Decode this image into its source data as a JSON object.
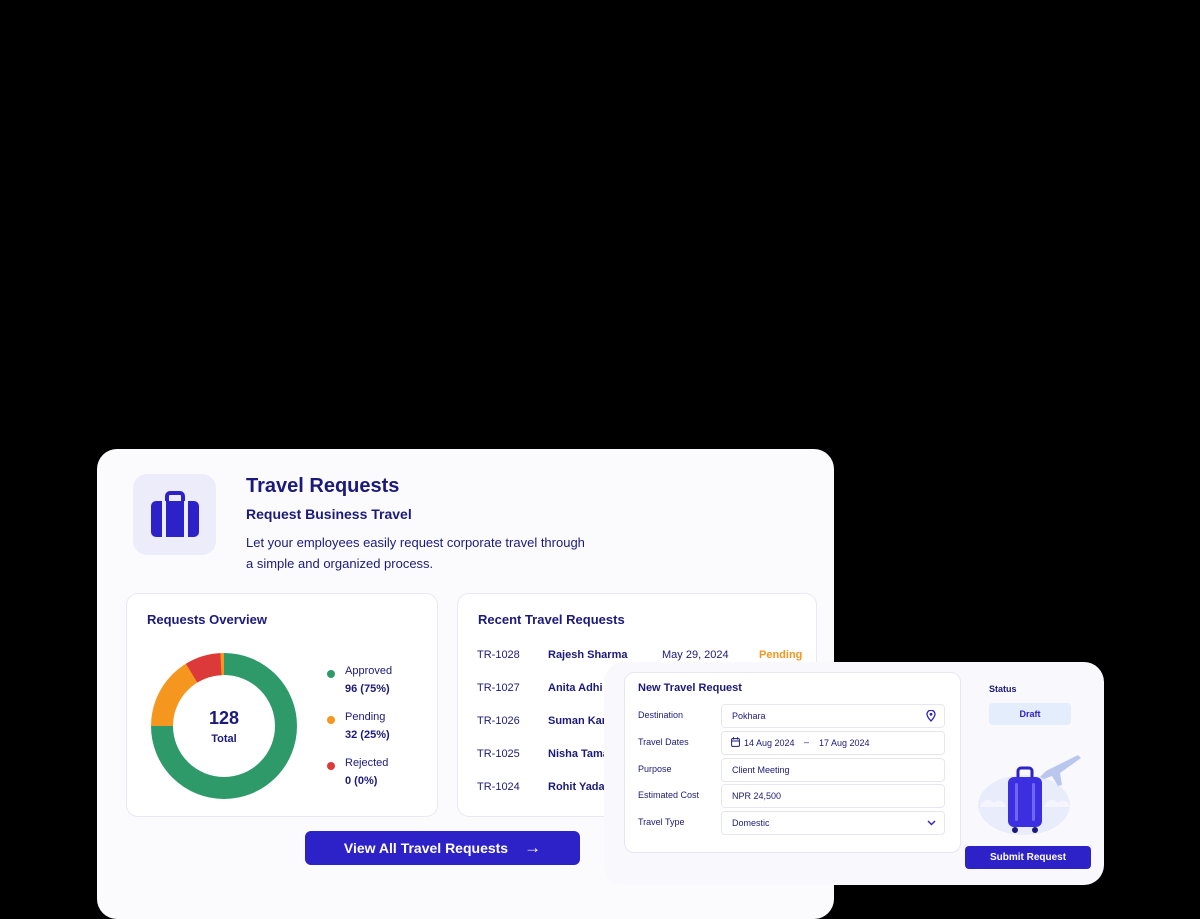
{
  "header": {
    "icon": "suitcase-icon",
    "title": "Travel Requests",
    "subtitle": "Request Business Travel",
    "description": "Let your employees easily request corporate travel through a simple and organized process."
  },
  "overview": {
    "title": "Requests Overview",
    "total": "128",
    "total_label": "Total",
    "legend": [
      {
        "name": "Approved",
        "value": "96 (75%)",
        "color": "#2f9a69"
      },
      {
        "name": "Pending",
        "value": "32 (25%)",
        "color": "#f5961e"
      },
      {
        "name": "Rejected",
        "value": "0 (0%)",
        "color": "#dc3a3a"
      }
    ]
  },
  "chart_data": {
    "type": "pie",
    "categories": [
      "Approved",
      "Pending",
      "Rejected"
    ],
    "values": [
      96,
      32,
      0
    ],
    "total": 128
  },
  "recent": {
    "title": "Recent Travel Requests",
    "rows": [
      {
        "id": "TR-1028",
        "name": "Rajesh Sharma",
        "date": "May 29, 2024",
        "status": "Pending"
      },
      {
        "id": "TR-1027",
        "name": "Anita Adhi",
        "date": "",
        "status": ""
      },
      {
        "id": "TR-1026",
        "name": "Suman Kar",
        "date": "",
        "status": ""
      },
      {
        "id": "TR-1025",
        "name": "Nisha Tama",
        "date": "",
        "status": ""
      },
      {
        "id": "TR-1024",
        "name": "Rohit Yada",
        "date": "",
        "status": ""
      }
    ]
  },
  "view_all_label": "View All Travel Requests",
  "form": {
    "title": "New Travel Request",
    "destination_label": "Destination",
    "destination_value": "Pokhara",
    "dates_label": "Travel Dates",
    "date_from": "14 Aug 2024",
    "date_separator": "–",
    "date_to": "17 Aug 2024",
    "purpose_label": "Purpose",
    "purpose_value": "Client Meeting",
    "cost_label": "Estimated Cost",
    "cost_value": "NPR 24,500",
    "type_label": "Travel Type",
    "type_value": "Domestic",
    "status_label": "Status",
    "status_value": "Draft",
    "submit_label": "Submit Request"
  },
  "colors": {
    "accent": "#2d21c8",
    "pending": "#f5961e",
    "text": "#1b1a7a"
  }
}
